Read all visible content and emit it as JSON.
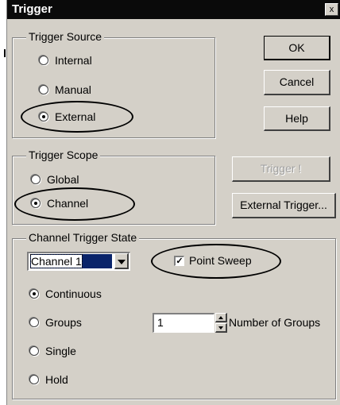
{
  "window": {
    "title": "Trigger",
    "close_glyph": "x"
  },
  "trigger_source": {
    "label": "Trigger Source",
    "options": [
      {
        "label": "Internal",
        "selected": false
      },
      {
        "label": "Manual",
        "selected": false
      },
      {
        "label": "External",
        "selected": true
      }
    ]
  },
  "trigger_scope": {
    "label": "Trigger Scope",
    "options": [
      {
        "label": "Global",
        "selected": false
      },
      {
        "label": "Channel",
        "selected": true
      }
    ]
  },
  "buttons": {
    "ok": "OK",
    "cancel": "Cancel",
    "help": "Help",
    "trigger": "Trigger !",
    "external_trigger": "External Trigger..."
  },
  "channel_state": {
    "label": "Channel Trigger State",
    "channel_select": "Channel 1",
    "point_sweep_label": "Point Sweep",
    "point_sweep_checked": true,
    "modes": [
      {
        "label": "Continuous",
        "selected": true
      },
      {
        "label": "Groups",
        "selected": false
      },
      {
        "label": "Single",
        "selected": false
      },
      {
        "label": "Hold",
        "selected": false
      }
    ],
    "groups_value": "1",
    "groups_label": "Number of Groups"
  }
}
